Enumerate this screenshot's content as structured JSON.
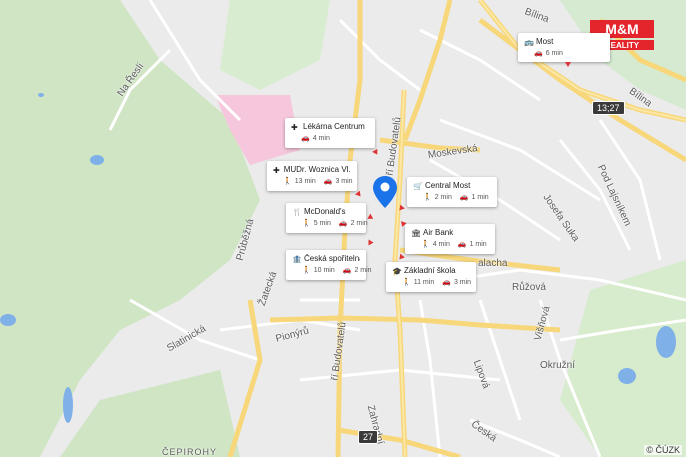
{
  "streets": [
    {
      "id": "na-resli",
      "label": "Na Řesli"
    },
    {
      "id": "moskevska",
      "label": "Moskevská"
    },
    {
      "id": "bilina1",
      "label": "Bílina"
    },
    {
      "id": "bilina2",
      "label": "Bílina"
    },
    {
      "id": "pod-lajsnikem",
      "label": "Pod Lajsníkem"
    },
    {
      "id": "josefa-suka",
      "label": "Josefa Suka"
    },
    {
      "id": "ji-budovatelu1",
      "label": "ří Budovatelů"
    },
    {
      "id": "ji-budovatelu2",
      "label": "ří Budovatelů"
    },
    {
      "id": "prubezna",
      "label": "Průběžná"
    },
    {
      "id": "zatecka",
      "label": "Žatecká"
    },
    {
      "id": "slatinicka",
      "label": "Slatinická"
    },
    {
      "id": "pionyru",
      "label": "Pionýrů"
    },
    {
      "id": "zahradni",
      "label": "Zahradní"
    },
    {
      "id": "lipova",
      "label": "Lipová"
    },
    {
      "id": "ruzova",
      "label": "Růžová"
    },
    {
      "id": "viskova",
      "label": "Višňová"
    },
    {
      "id": "okruzni",
      "label": "Okružní"
    },
    {
      "id": "ceska",
      "label": "Česká"
    },
    {
      "id": "palacha",
      "label": "alacha"
    },
    {
      "id": "cepirohy",
      "label": "ČEPIROHY"
    }
  ],
  "route_badges": [
    {
      "id": "13-27",
      "label": "13;27"
    },
    {
      "id": "27",
      "label": "27"
    }
  ],
  "pois": [
    {
      "id": "most",
      "icon": "bus-icon",
      "name": "Most",
      "car": "6 min",
      "walk": ""
    },
    {
      "id": "lekarna",
      "icon": "pharmacy-icon",
      "name": "Lékárna Centrum",
      "car": "4 min",
      "walk": ""
    },
    {
      "id": "mudr",
      "icon": "pharmacy-icon",
      "name": "MUDr. Woznica Vl...",
      "walk": "13 min",
      "car": "3 min"
    },
    {
      "id": "central",
      "icon": "cart-icon",
      "name": "Central Most",
      "walk": "2 min",
      "car": "1 min"
    },
    {
      "id": "mcdonalds",
      "icon": "restaurant-icon",
      "name": "McDonald's",
      "walk": "5 min",
      "car": "2 min"
    },
    {
      "id": "airbank",
      "icon": "bank-icon",
      "name": "Air Bank",
      "walk": "4 min",
      "car": "1 min"
    },
    {
      "id": "sporitelna",
      "icon": "bank-safe-icon",
      "name": "Česká spořitelna",
      "walk": "10 min",
      "car": "2 min"
    },
    {
      "id": "skola",
      "icon": "school-icon",
      "name": "Základní škola",
      "walk": "11 min",
      "car": "3 min"
    }
  ],
  "watermark": "M&M REALITY",
  "attribution": "© ČÚZK",
  "colors": {
    "water": "#7fb0e8",
    "green": "#c9e3bf",
    "road_major": "#f7d77a",
    "road_minor": "#ffffff",
    "pink": "#f7c6dd",
    "marker": "#1a73e8"
  }
}
